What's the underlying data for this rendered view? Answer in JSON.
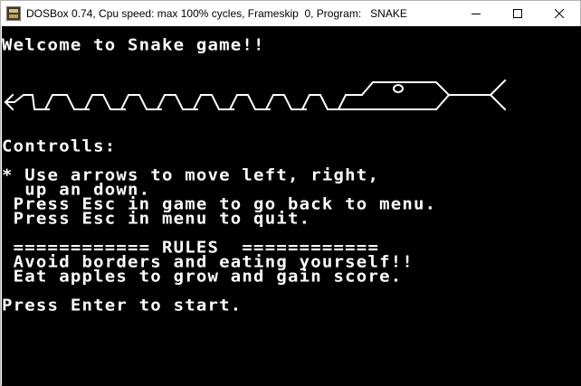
{
  "window": {
    "title": "DOSBox 0.74, Cpu speed: max 100% cycles, Frameskip  0, Program:   SNAKE"
  },
  "screen": {
    "welcome": "Welcome to Snake game!!",
    "controls_heading": "Controlls:",
    "bullet_line1": "* Use arrows to move left, right,",
    "bullet_line2": "  up an down.",
    "esc_game": " Press Esc in game to go back to menu.",
    "esc_menu": " Press Esc in menu to quit.",
    "rules_header": " ============ RULES  ============",
    "rule1": " Avoid borders and eating yourself!!",
    "rule2": " Eat apples to grow and gain score.",
    "start_prompt": "Press Enter to start."
  }
}
